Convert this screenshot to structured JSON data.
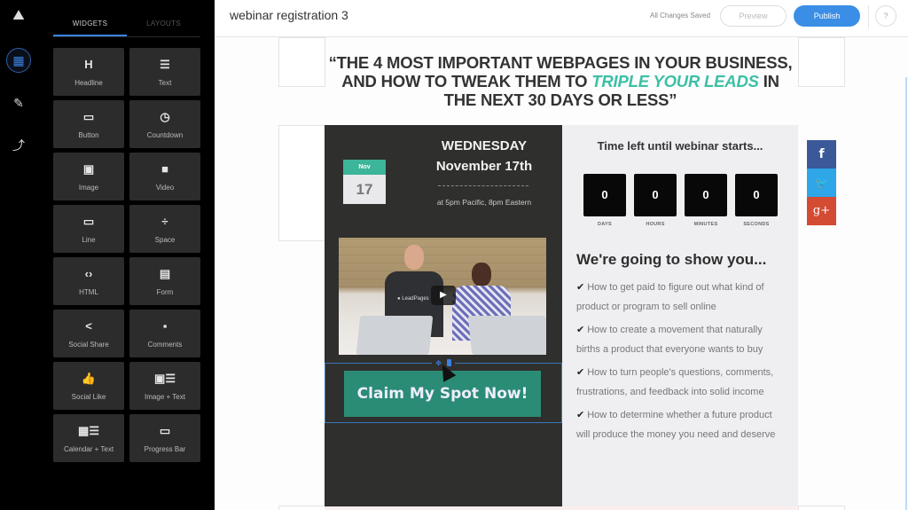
{
  "rail": {
    "items": [
      {
        "name": "widgets",
        "icon": "▦",
        "active": true
      },
      {
        "name": "style",
        "icon": "✎",
        "active": false
      },
      {
        "name": "analytics",
        "icon": "⤴",
        "active": false
      }
    ]
  },
  "panel": {
    "tabs": [
      {
        "label": "WIDGETS",
        "active": true
      },
      {
        "label": "LAYOUTS",
        "active": false
      }
    ],
    "widgets": [
      {
        "icon": "H",
        "label": "Headline"
      },
      {
        "icon": "☰",
        "label": "Text"
      },
      {
        "icon": "▭",
        "label": "Button"
      },
      {
        "icon": "◷",
        "label": "Countdown"
      },
      {
        "icon": "▣",
        "label": "Image"
      },
      {
        "icon": "■",
        "label": "Video"
      },
      {
        "icon": "▭",
        "label": "Line"
      },
      {
        "icon": "÷",
        "label": "Space"
      },
      {
        "icon": "‹›",
        "label": "HTML"
      },
      {
        "icon": "▤",
        "label": "Form"
      },
      {
        "icon": "<",
        "label": "Social Share"
      },
      {
        "icon": "▪",
        "label": "Comments"
      },
      {
        "icon": "👍",
        "label": "Social Like"
      },
      {
        "icon": "▣☰",
        "label": "Image + Text"
      },
      {
        "icon": "▦☰",
        "label": "Calendar + Text"
      },
      {
        "icon": "▭",
        "label": "Progress Bar"
      }
    ]
  },
  "topbar": {
    "title": "webinar registration 3",
    "status": "All Changes Saved",
    "preview_label": "Preview",
    "publish_label": "Publish",
    "help_label": "?"
  },
  "page": {
    "headline_part1": "“THE 4 MOST IMPORTANT WEBPAGES IN YOUR BUSINESS, AND HOW TO TWEAK THEM TO ",
    "headline_highlight": "TRIPLE YOUR LEADS",
    "headline_part2": " IN THE NEXT 30 DAYS OR LESS”",
    "calendar": {
      "month": "Nov",
      "day": "17"
    },
    "day_name": "WEDNESDAY",
    "date": "November 17th",
    "time": "at 5pm Pacific, 8pm Eastern",
    "video": {
      "shirt_text": "● LeadPages",
      "play_icon": "▶"
    },
    "cta_label": "Claim My Spot Now!",
    "countdown": {
      "title": "Time left until webinar starts...",
      "units": [
        {
          "value": "0",
          "label": "DAYS"
        },
        {
          "value": "0",
          "label": "HOURS"
        },
        {
          "value": "0",
          "label": "MINUTES"
        },
        {
          "value": "0",
          "label": "SECONDS"
        }
      ]
    },
    "show_title": "We're going to show you...",
    "bullets": [
      "How to get paid to figure out what kind of product or program to sell online",
      "How to create a movement that naturally births a product that everyone wants to buy",
      "How to turn people's questions, comments, frustrations, and feedback into solid income",
      "How to determine whether a future product will produce the money you need and deserve"
    ],
    "social": [
      {
        "name": "facebook",
        "glyph": "f",
        "color": "#3b5998"
      },
      {
        "name": "twitter",
        "glyph": "🐦",
        "color": "#2fa6e8"
      },
      {
        "name": "google-plus",
        "glyph": "g+",
        "color": "#d44b33"
      }
    ]
  },
  "colors": {
    "accent": "#3a8ee6",
    "teal_highlight": "#3cbfa5",
    "cta": "#2b8c75",
    "dark_panel": "#2f2f2d"
  }
}
